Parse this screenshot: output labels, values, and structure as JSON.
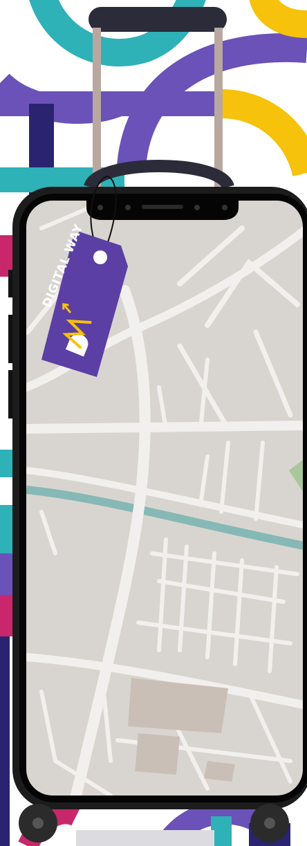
{
  "tag": {
    "brand_text": "DIGITAL WAY"
  },
  "colors": {
    "teal": "#2fb1b8",
    "purple": "#6a52b8",
    "navy": "#2a2370",
    "yellow": "#f6c20b",
    "magenta": "#c8286b",
    "map_bg": "#d8d5d0",
    "map_road": "#f1f0ee",
    "river": "#86b8b6",
    "tag": "#5b3fa4",
    "phone_frame": "#1c1c1c"
  },
  "icons": {
    "logo": "dw-logo-icon",
    "arrow": "up-arrow-icon"
  }
}
